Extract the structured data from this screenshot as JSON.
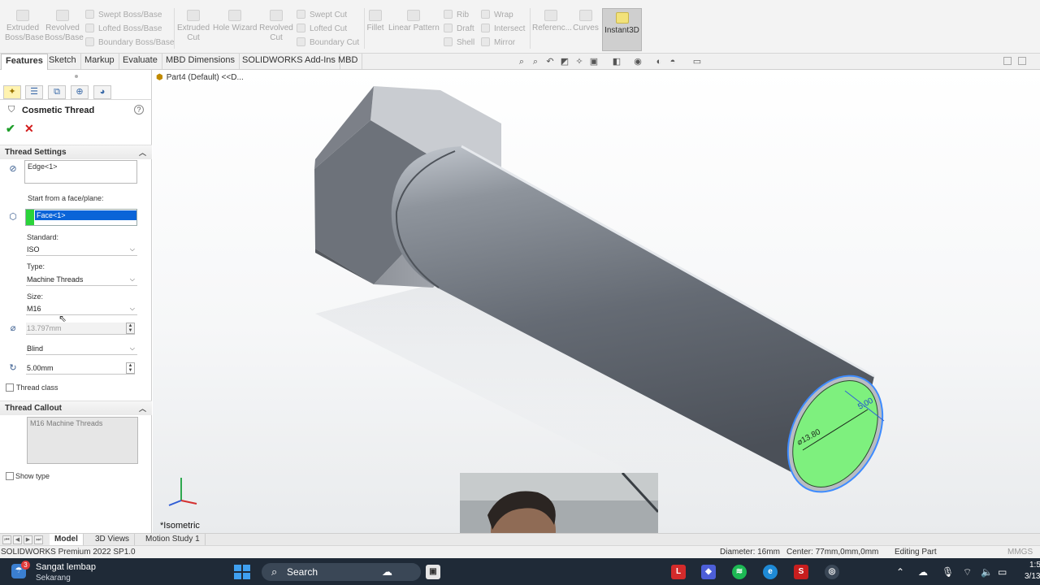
{
  "ribbon": {
    "extruded_boss": "Extruded\nBoss/Base",
    "revolved_boss": "Revolved\nBoss/Base",
    "swept_boss": "Swept Boss/Base",
    "lofted_boss": "Lofted Boss/Base",
    "boundary_boss": "Boundary Boss/Base",
    "extruded_cut": "Extruded\nCut",
    "hole_wizard": "Hole Wizard",
    "revolved_cut": "Revolved\nCut",
    "swept_cut": "Swept Cut",
    "lofted_cut": "Lofted Cut",
    "boundary_cut": "Boundary Cut",
    "fillet": "Fillet",
    "linear_pattern": "Linear Pattern",
    "rib": "Rib",
    "draft": "Draft",
    "shell": "Shell",
    "wrap": "Wrap",
    "intersect": "Intersect",
    "mirror": "Mirror",
    "reference": "Referenc...",
    "curves": "Curves",
    "instant3d": "Instant3D"
  },
  "command_tabs": [
    "Features",
    "Sketch",
    "Markup",
    "Evaluate",
    "MBD Dimensions",
    "SOLIDWORKS Add-Ins",
    "MBD"
  ],
  "property_manager": {
    "title": "Cosmetic Thread",
    "ok_symbol": "✔",
    "cancel_symbol": "✕",
    "thread_settings": {
      "header": "Thread Settings",
      "edge_value": "Edge<1>",
      "start_label": "Start from a face/plane:",
      "face_value": "Face<1>",
      "standard_label": "Standard:",
      "standard_value": "ISO",
      "type_label": "Type:",
      "type_value": "Machine Threads",
      "size_label": "Size:",
      "size_value": "M16",
      "diameter_value": "13.797mm",
      "end_condition_value": "Blind",
      "depth_value": "5.00mm",
      "thread_class_label": "Thread class"
    },
    "thread_callout": {
      "header": "Thread Callout",
      "callout_text": "M16 Machine Threads",
      "show_type_label": "Show type"
    }
  },
  "viewport": {
    "breadcrumb": "Part4 (Default) <<D...",
    "view_label": "*Isometric",
    "dim_depth": "5.00",
    "dim_diameter": "⌀13.80",
    "colors": {
      "thread_face": "#7ef07e",
      "body_dark": "#5f656e",
      "body_light": "#b9bec6",
      "highlight_edge": "#3d8bff"
    }
  },
  "bottom_tabs": [
    "Model",
    "3D Views",
    "Motion Study 1"
  ],
  "status_bar": {
    "product": "SOLIDWORKS Premium 2022 SP1.0",
    "diameter": "Diameter: 16mm",
    "center": "Center: 77mm,0mm,0mm",
    "mode": "Editing Part",
    "units": "MMGS"
  },
  "taskbar": {
    "notif_badge": "3",
    "notif_title": "Sangat lembap",
    "notif_sub": "Sekarang",
    "search_label": "Search",
    "clock_time": "1:5",
    "clock_date": "3/13"
  }
}
